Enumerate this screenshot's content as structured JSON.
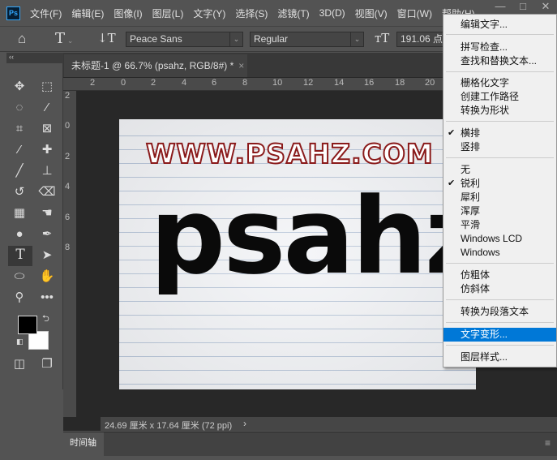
{
  "app": {
    "logo": "Ps",
    "menus": [
      "文件(F)",
      "编辑(E)",
      "图像(I)",
      "图层(L)",
      "文字(Y)",
      "选择(S)",
      "滤镜(T)",
      "3D(D)",
      "视图(V)",
      "窗口(W)",
      "帮助(H)"
    ]
  },
  "options": {
    "font_family": "Peace Sans",
    "font_style": "Regular",
    "font_size": "191.06 点"
  },
  "document": {
    "tab_title": "未标题-1 @ 66.7% (psahz, RGB/8#) *",
    "status": "24.69 厘米 x 17.64 厘米 (72 ppi)",
    "canvas_text_small": "WWW.PSAHZ.COM",
    "canvas_text_big": "psahz"
  },
  "rulers": {
    "h": [
      "2",
      "0",
      "2",
      "4",
      "6",
      "8",
      "10",
      "12",
      "14",
      "16",
      "18",
      "20"
    ],
    "v": [
      "2",
      "0",
      "2",
      "4",
      "6",
      "8"
    ]
  },
  "panel": {
    "timeline": "时间轴"
  },
  "colors": {
    "foreground": "#000000",
    "background": "#ffffff",
    "highlight": "#0078d7"
  },
  "context_menu": {
    "items": [
      {
        "label": "编辑文字..."
      },
      {
        "label": "拼写检查..."
      },
      {
        "label": "查找和替换文本..."
      },
      {
        "label": "栅格化文字"
      },
      {
        "label": "创建工作路径"
      },
      {
        "label": "转换为形状"
      },
      {
        "label": "横排",
        "checked": true
      },
      {
        "label": "竖排"
      },
      {
        "label": "无"
      },
      {
        "label": "锐利",
        "checked": true
      },
      {
        "label": "犀利"
      },
      {
        "label": "浑厚"
      },
      {
        "label": "平滑"
      },
      {
        "label": "Windows LCD"
      },
      {
        "label": "Windows"
      },
      {
        "label": "仿粗体"
      },
      {
        "label": "仿斜体"
      },
      {
        "label": "转换为段落文本"
      },
      {
        "label": "文字变形...",
        "highlighted": true
      },
      {
        "label": "图层样式..."
      }
    ]
  }
}
